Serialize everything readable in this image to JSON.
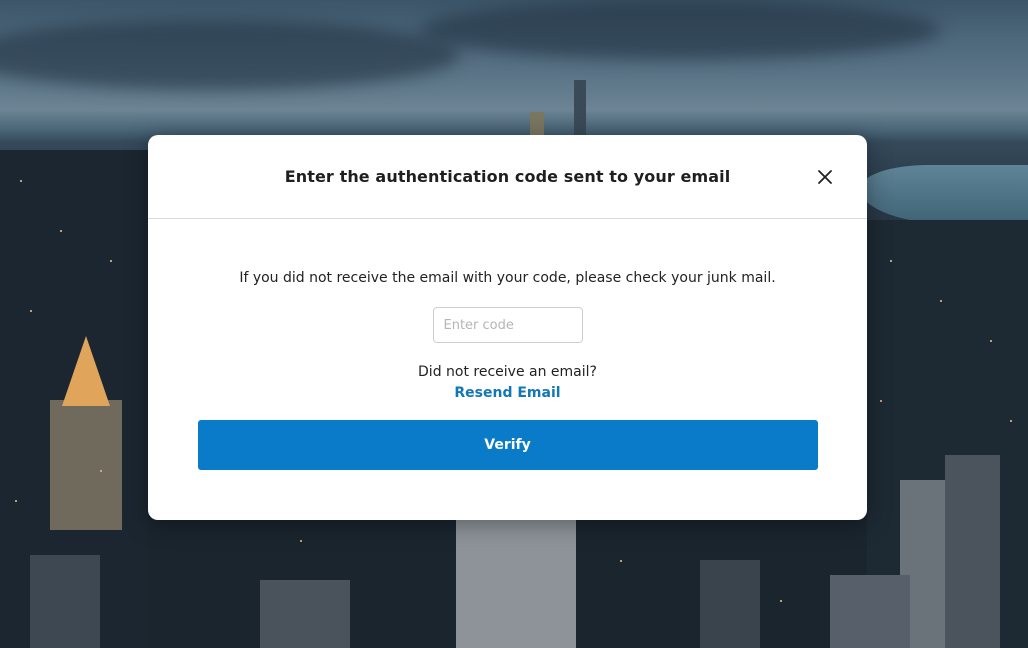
{
  "modal": {
    "title": "Enter the authentication code sent to your email",
    "close_icon": "close-icon",
    "info_text": "If you did not receive the email with your code, please check your junk mail.",
    "code_input": {
      "placeholder": "Enter code",
      "value": ""
    },
    "no_email_text": "Did not receive an email?",
    "resend_label": "Resend Email",
    "verify_label": "Verify"
  },
  "colors": {
    "primary_button": "#0a7bc9",
    "link": "#1377b5",
    "modal_background": "#ffffff"
  }
}
